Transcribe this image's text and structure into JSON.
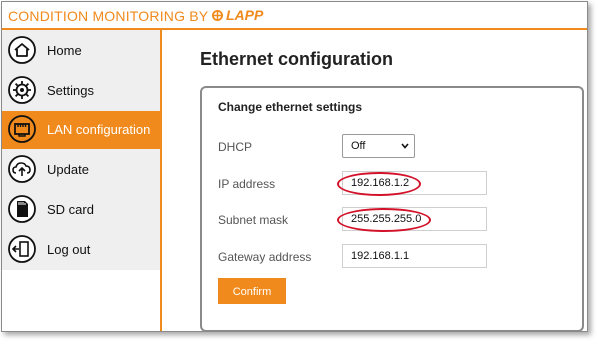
{
  "header": {
    "brand_text": "CONDITION MONITORING BY",
    "logo_text": "LAPP",
    "accent_color": "#f08a1c"
  },
  "sidebar": {
    "items": [
      {
        "label": "Home",
        "icon": "home-icon"
      },
      {
        "label": "Settings",
        "icon": "gear-icon"
      },
      {
        "label": "LAN configuration",
        "icon": "lan-icon",
        "active": true
      },
      {
        "label": "Update",
        "icon": "cloud-upload-icon"
      },
      {
        "label": "SD card",
        "icon": "sd-card-icon"
      },
      {
        "label": "Log out",
        "icon": "logout-icon"
      }
    ]
  },
  "main": {
    "title": "Ethernet configuration",
    "card_title": "Change ethernet settings",
    "dhcp": {
      "label": "DHCP",
      "value": "Off"
    },
    "ip": {
      "label": "IP address",
      "value": "192.168.1.2"
    },
    "subnet": {
      "label": "Subnet mask",
      "value": "255.255.255.0"
    },
    "gateway": {
      "label": "Gateway address",
      "value": "192.168.1.1"
    },
    "confirm_label": "Confirm"
  },
  "annotation_color": "#d3122a"
}
